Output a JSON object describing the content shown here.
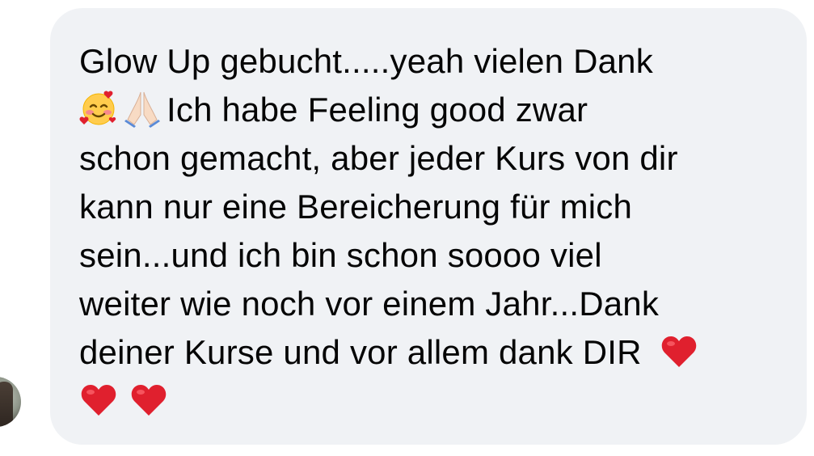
{
  "message": {
    "lines": [
      "Glow Up gebucht.....yeah vielen Dank",
      "Ich habe Feeling good zwar",
      "schon gemacht, aber jeder Kurs von dir",
      "kann nur eine Bereicherung für mich",
      "sein...und ich bin schon soooo viel",
      "weiter wie noch vor einem Jahr...Dank",
      "deiner Kurse und vor allem dank DIR"
    ],
    "emojis": [
      "smiling-face-with-hearts",
      "folded-hands",
      "red-heart",
      "red-heart",
      "red-heart"
    ]
  },
  "colors": {
    "bubble": "#f0f2f5",
    "text": "#050505",
    "heart": "#e0202e"
  }
}
